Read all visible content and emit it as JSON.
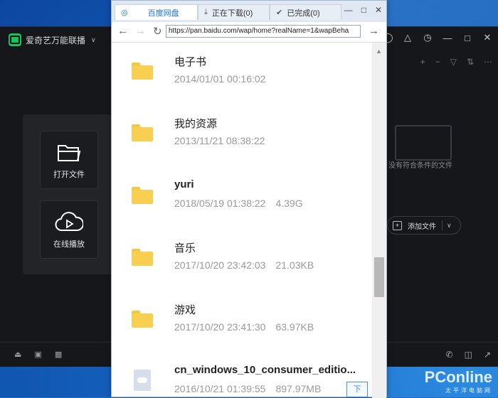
{
  "player": {
    "title": "爱奇艺万能联播",
    "tiles": [
      {
        "label": "打开文件",
        "icon": "folder-open-icon"
      },
      {
        "label": "在线播放",
        "icon": "cloud-play-icon"
      }
    ],
    "empty_text": "没有符合条件的文件",
    "add_file_label": "添加文件"
  },
  "browser": {
    "tabs": [
      {
        "label": "百度网盘",
        "active": true
      },
      {
        "label": "正在下载(0)",
        "active": false
      },
      {
        "label": "已完成(0)",
        "active": false
      }
    ],
    "url": "https://pan.baidu.com/wap/home?realName=1&wapBeha",
    "files": [
      {
        "name": "电子书",
        "date": "2014/01/01 00:16:02",
        "size": "",
        "type": "folder"
      },
      {
        "name": "我的资源",
        "date": "2013/11/21 08:38:22",
        "size": "",
        "type": "folder"
      },
      {
        "name": "yuri",
        "date": "2018/05/19 01:38:22",
        "size": "4.39G",
        "type": "folder"
      },
      {
        "name": "音乐",
        "date": "2017/10/20 23:42:03",
        "size": "21.03KB",
        "type": "folder"
      },
      {
        "name": "游戏",
        "date": "2017/10/20 23:41:30",
        "size": "63.97KB",
        "type": "folder"
      },
      {
        "name": "cn_windows_10_consumer_editio...",
        "date": "2016/10/21 01:39:55",
        "size": "897.97MB",
        "type": "file"
      }
    ],
    "float_button": "下"
  },
  "watermark": {
    "brand": "PConline",
    "sub": "太平洋电脑网"
  },
  "colors": {
    "folder": "#f9cf52",
    "accent": "#1a73e8",
    "player_bg": "#16171b",
    "desktop": "#1565c0"
  }
}
